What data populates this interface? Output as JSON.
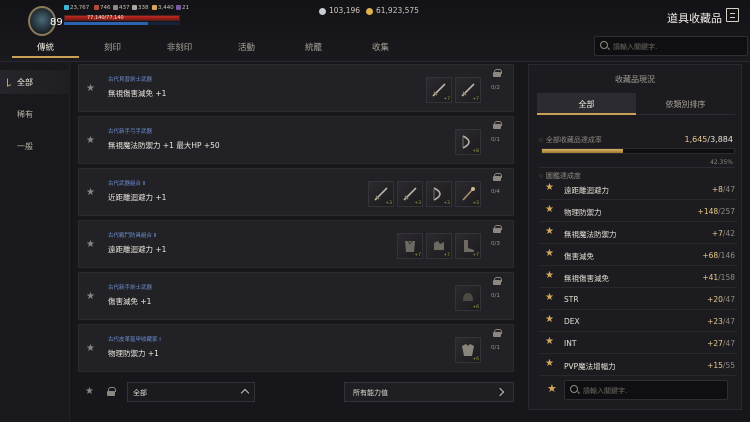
{
  "player": {
    "level": "89",
    "stats": [
      {
        "icon": "cyan-gem-icon",
        "value": "23,767"
      },
      {
        "icon": "red-bag-icon",
        "value": "746"
      },
      {
        "icon": "shield-icon",
        "value": "437"
      },
      {
        "icon": "crossed-swords-icon",
        "value": "338"
      },
      {
        "icon": "gold-coin-small-icon",
        "value": "3,440"
      },
      {
        "icon": "potion-icon",
        "value": "21"
      }
    ],
    "hp_text": "77,140/77,140"
  },
  "currency": {
    "silver": "103,196",
    "gold": "61,923,575"
  },
  "header": {
    "title": "道具收藏品"
  },
  "tabs": [
    "傳統",
    "刻印",
    "非刻印",
    "活動",
    "統籠",
    "收集"
  ],
  "search": {
    "placeholder": "請輸入關鍵字."
  },
  "sidebar": {
    "items": [
      "全部",
      "稀有",
      "一般"
    ]
  },
  "collections": [
    {
      "category": "古代見習劍士武器",
      "effect": "無視傷害減免 +1",
      "count": "0/2",
      "slots": [
        "+7",
        "+7"
      ]
    },
    {
      "category": "古代新手弓手武器",
      "effect": "無視魔法防禦力 +1 最大HP +50",
      "count": "0/1",
      "slots": [
        "+8"
      ]
    },
    {
      "category": "古代武器組合 Ⅱ",
      "effect": "近距離迴避力 +1",
      "count": "0/4",
      "slots": [
        "+3",
        "+3",
        "+3",
        "+3"
      ]
    },
    {
      "category": "古代戰鬥防具組合 Ⅱ",
      "effect": "遠距離迴避力 +1",
      "count": "0/3",
      "slots": [
        "+7",
        "+7",
        "+7"
      ]
    },
    {
      "category": "古代新手劍士武器",
      "effect": "傷害減免 +1",
      "count": "0/1",
      "slots": [
        "+6"
      ]
    },
    {
      "category": "古代皮革盔甲收藏家 Ⅰ",
      "effect": "物理防禦力 +1",
      "count": "0/1",
      "slots": [
        "+6"
      ]
    }
  ],
  "filters": {
    "dropdown_label": "全部",
    "ability_label": "所有能力值"
  },
  "panel": {
    "title": "收藏品現況",
    "tabs": [
      "全部",
      "依類別排序"
    ],
    "total_label": "全部收藏品達成率",
    "total_done": "1,645",
    "total_all": "/3,884",
    "progress_percent": "42.35%",
    "progress_fraction": 0.4235,
    "section_label": "圖鑑達成度",
    "stats": [
      {
        "name": "遠距離迴避力",
        "done": "+8",
        "total": "/47"
      },
      {
        "name": "物理防禦力",
        "done": "+148",
        "total": "/257"
      },
      {
        "name": "無視魔法防禦力",
        "done": "+7",
        "total": "/42"
      },
      {
        "name": "傷害減免",
        "done": "+68",
        "total": "/146"
      },
      {
        "name": "無視傷害減免",
        "done": "+41",
        "total": "/158"
      },
      {
        "name": "STR",
        "done": "+20",
        "total": "/47"
      },
      {
        "name": "DEX",
        "done": "+23",
        "total": "/47"
      },
      {
        "name": "INT",
        "done": "+27",
        "total": "/47"
      },
      {
        "name": "PVP魔法增幅力",
        "done": "+15",
        "total": "/55"
      }
    ],
    "search_placeholder": "請輸入關鍵字."
  },
  "colors": {
    "accent_gold": "#c9a157",
    "category_blue": "#6d8fd0",
    "hp_red": "#c02a22"
  }
}
